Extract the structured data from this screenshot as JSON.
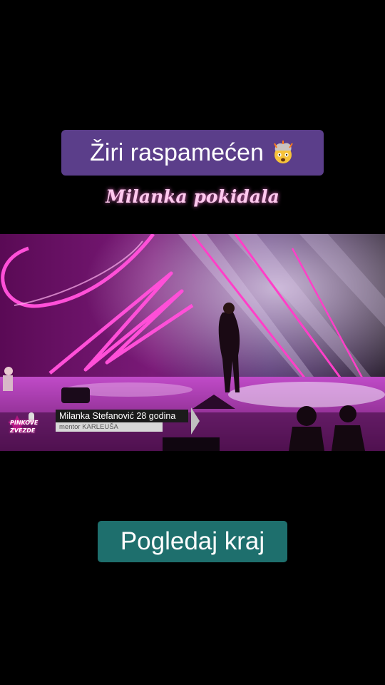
{
  "overlay": {
    "title": "Žiri raspamećen",
    "title_emoji": "exploding-head-emoji",
    "subtitle": "Milanka pokidala",
    "cta_label": "Pogledaj kraj"
  },
  "video": {
    "show_logo_line1": "PINKOVE",
    "show_logo_line2": "ZVEZDE",
    "contestant_caption": "Milanka Stefanović 28 godina",
    "mentor_caption": "mentor KARLEUŠA"
  },
  "colors": {
    "background": "#000000",
    "title_box": "#5b3e8a",
    "subtitle_glow": "#ff78dc",
    "cta_box": "#1e6f6d",
    "neon_pink": "#ff4fd8"
  }
}
